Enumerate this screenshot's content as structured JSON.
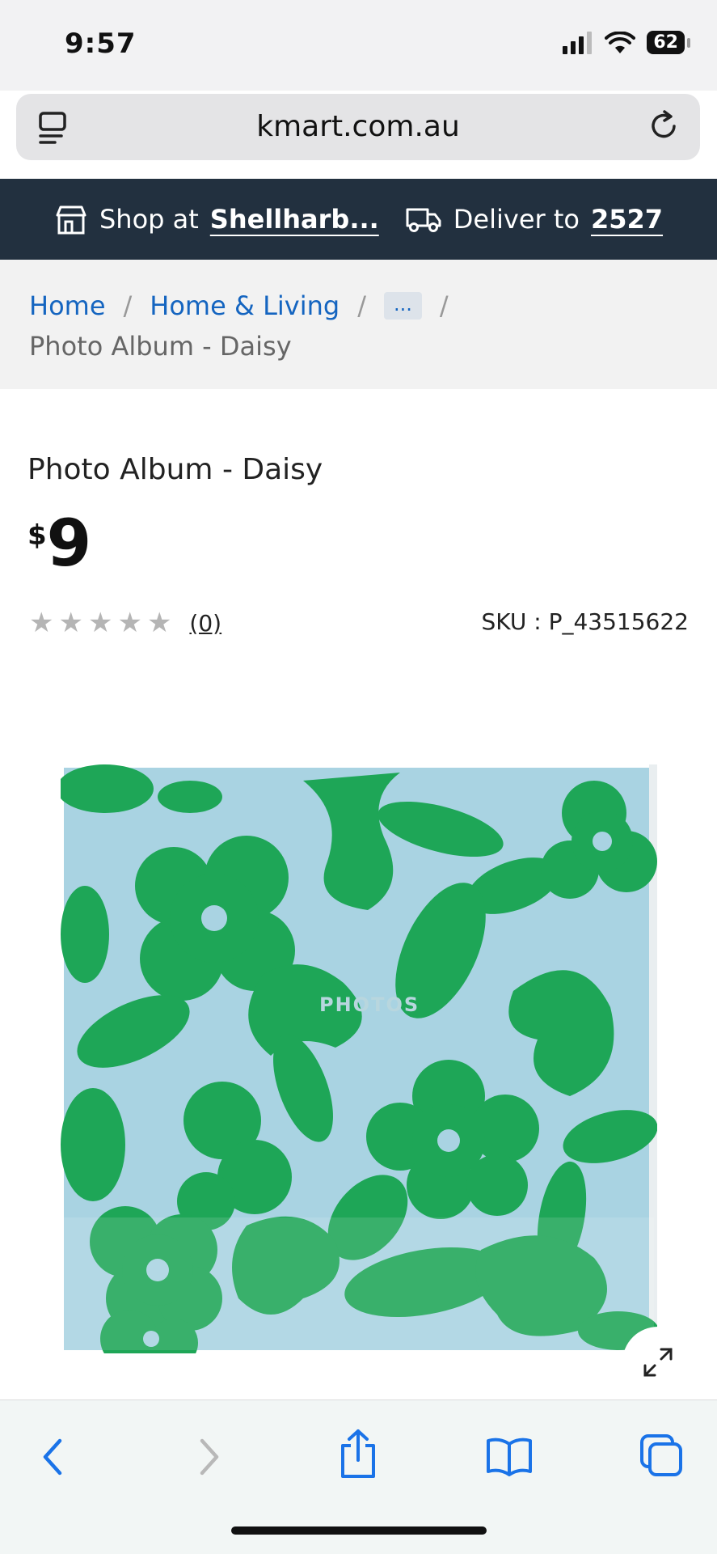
{
  "status_bar": {
    "time": "9:57",
    "battery": "62"
  },
  "browser": {
    "url": "kmart.com.au"
  },
  "store_bar": {
    "shop_prefix": "Shop at",
    "store": "Shellharb...",
    "deliver_prefix": "Deliver to",
    "postcode": "2527"
  },
  "breadcrumb": {
    "items": [
      "Home",
      "Home & Living"
    ],
    "more": "...",
    "current": "Photo Album - Daisy"
  },
  "product": {
    "title": "Photo Album - Daisy",
    "currency": "$",
    "price": "9",
    "rating": 0,
    "review_count": "(0)",
    "sku": "SKU : P_43515622",
    "image_text": "PHOTOS"
  },
  "colors": {
    "store_bar_bg": "#22303f",
    "link": "#1565c0",
    "album_bg": "#a9d3e2",
    "album_pattern": "#1ea657",
    "safari_accent": "#1a73e8"
  },
  "icons": {
    "store": "store-icon",
    "truck": "delivery-truck-icon",
    "tabs": "page-menu-icon",
    "reload": "reload-icon",
    "expand": "expand-icon",
    "back": "back-chevron-icon",
    "forward": "forward-chevron-icon",
    "share": "share-icon",
    "bookmarks": "bookmarks-icon",
    "tabs_overview": "tabs-icon"
  }
}
